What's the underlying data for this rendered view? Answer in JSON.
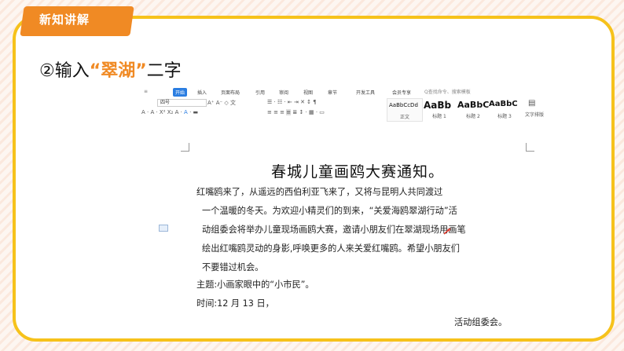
{
  "badge": {
    "label": "新知讲解"
  },
  "step": {
    "prefix": "②输入",
    "highlight": "“翠湖”",
    "suffix": "二字"
  },
  "ribbon": {
    "tabs": [
      "开始",
      "插入",
      "页面布局",
      "引用",
      "审阅",
      "视图",
      "章节",
      "开发工具",
      "会员专享"
    ],
    "active_tab": "开始",
    "search_placeholder": "Q查找命令、搜索模板",
    "font_size": "四号",
    "styles": [
      {
        "sample": "AaBbCcDd",
        "caption": "正文"
      },
      {
        "sample": "AaBb",
        "caption": "标题 1"
      },
      {
        "sample": "AaBbC",
        "caption": "标题 2"
      },
      {
        "sample": "AaBbC",
        "caption": "标题 3"
      }
    ],
    "text_layout_label": "文字排版"
  },
  "document": {
    "title": "春城儿童画鸥大赛通知。",
    "lines": [
      "红嘴鸥来了，从遥远的西伯利亚飞来了，又将与昆明人共同渡过",
      "一个温暖的冬天。为欢迎小精灵们的到来，“关爱海鸥翠湖行动”活",
      "动组委会将举办儿童现场画鸥大赛，邀请小朋友们在翠湖现场用画笔",
      "绘出红嘴鸥灵动的身影,呼唤更多的人来关爱红嘴鸥。希望小朋友们",
      "不要错过机会。"
    ],
    "theme": "主题:小画家眼中的“小市民”。",
    "time": "时间:12 月 13 日，",
    "signature": "活动组委会。"
  },
  "colors": {
    "accent": "#f08a24",
    "frame": "#f6c21b",
    "active_tab": "#2a7de1"
  }
}
